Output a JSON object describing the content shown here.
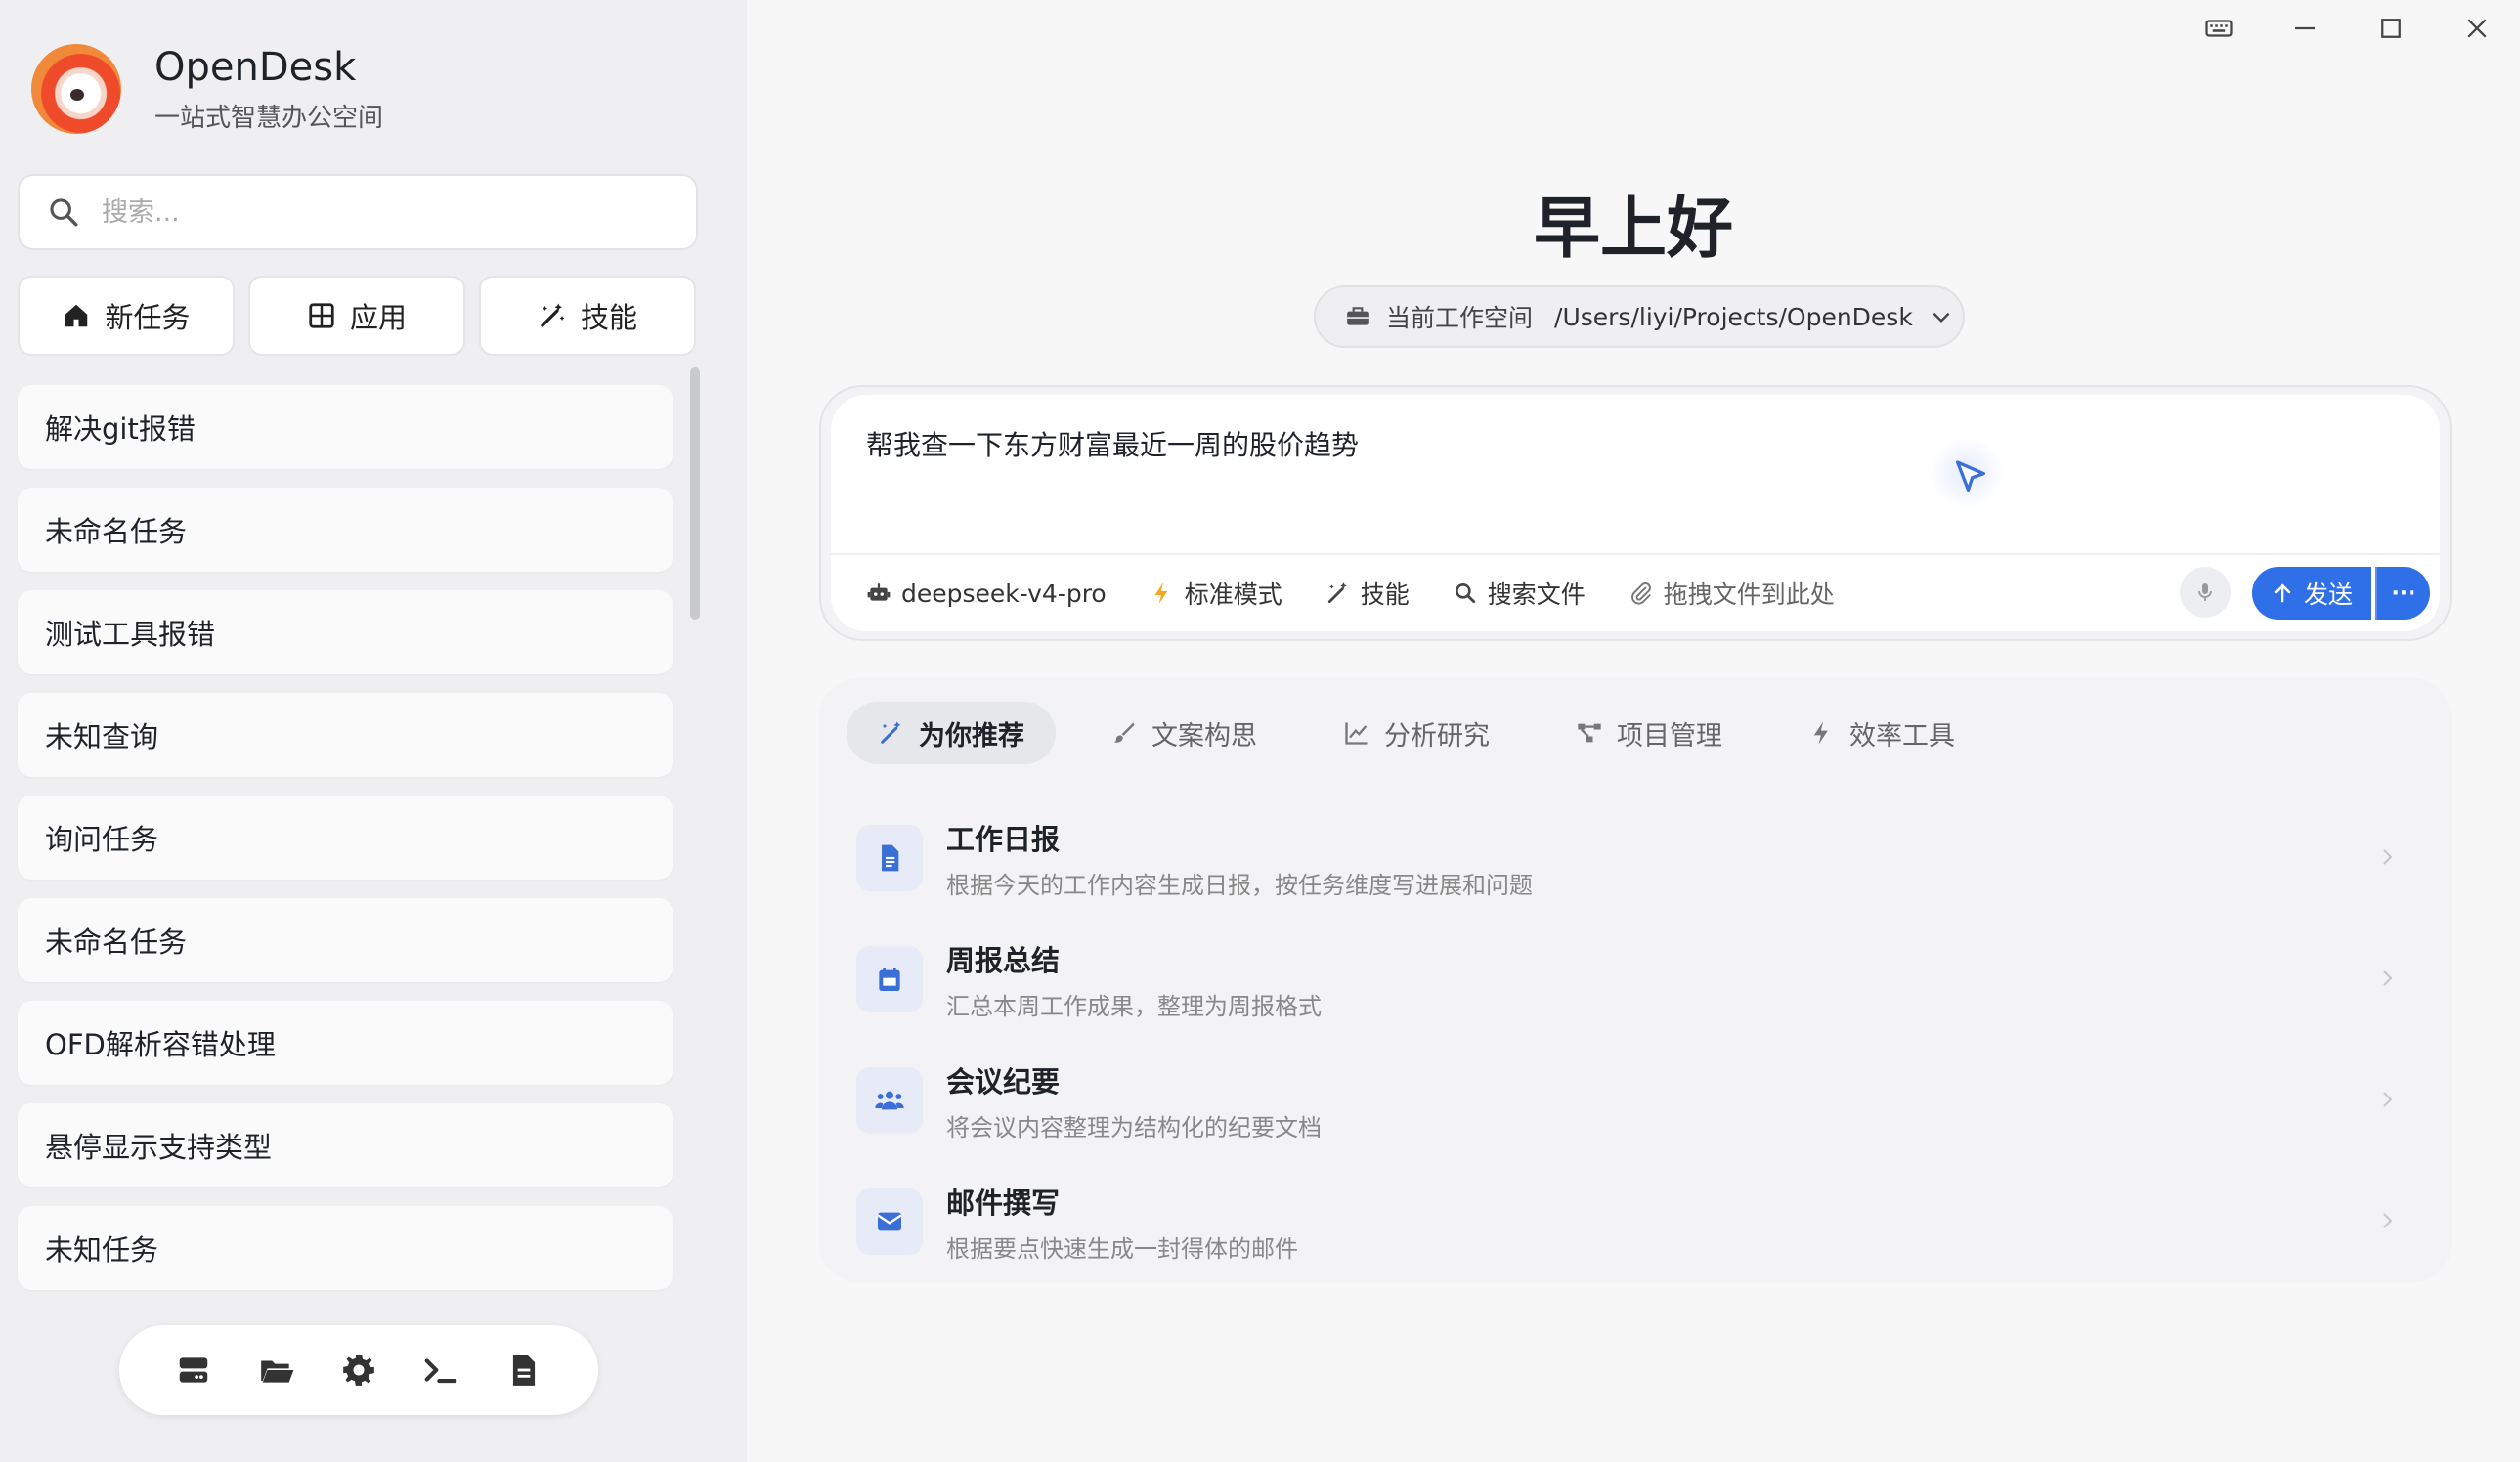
{
  "brand": {
    "title": "OpenDesk",
    "subtitle": "一站式智慧办公空间"
  },
  "search": {
    "placeholder": "搜索..."
  },
  "quick_actions": [
    {
      "label": "新任务",
      "icon": "home-icon"
    },
    {
      "label": "应用",
      "icon": "grid-icon"
    },
    {
      "label": "技能",
      "icon": "magic-wand-icon"
    }
  ],
  "tasks": [
    "解决git报错",
    "未命名任务",
    "测试工具报错",
    "未知查询",
    "询问任务",
    "未命名任务",
    "OFD解析容错处理",
    "悬停显示支持类型",
    "未知任务"
  ],
  "dock_icons": [
    "server-icon",
    "folder-open-icon",
    "gear-icon",
    "terminal-icon",
    "document-icon"
  ],
  "window_controls": [
    "keyboard-icon",
    "minimize-icon",
    "maximize-icon",
    "close-icon"
  ],
  "main": {
    "greeting": "早上好",
    "workspace": {
      "label": "当前工作空间",
      "path": "/Users/liyi/Projects/OpenDesk"
    },
    "composer": {
      "prompt": "帮我查一下东方财富最近一周的股价趋势",
      "model": "deepseek-v4-pro",
      "mode": "标准模式",
      "skills": "技能",
      "search_files": "搜索文件",
      "drop_hint": "拖拽文件到此处",
      "send": "发送",
      "more": "···"
    },
    "tabs": [
      {
        "label": "为你推荐",
        "icon": "magic-wand-icon",
        "active": true
      },
      {
        "label": "文案构思",
        "icon": "brush-icon"
      },
      {
        "label": "分析研究",
        "icon": "chart-line-icon"
      },
      {
        "label": "项目管理",
        "icon": "project-diagram-icon"
      },
      {
        "label": "效率工具",
        "icon": "bolt-icon"
      }
    ],
    "recommendations": [
      {
        "title": "工作日报",
        "desc": "根据今天的工作内容生成日报，按任务维度写进展和问题",
        "icon": "file-text-icon"
      },
      {
        "title": "周报总结",
        "desc": "汇总本周工作成果，整理为周报格式",
        "icon": "calendar-icon"
      },
      {
        "title": "会议纪要",
        "desc": "将会议内容整理为结构化的纪要文档",
        "icon": "users-icon"
      },
      {
        "title": "邮件撰写",
        "desc": "根据要点快速生成一封得体的邮件",
        "icon": "envelope-icon"
      }
    ]
  },
  "colors": {
    "accent": "#2f6fe8",
    "icon_accent": "#3b6fd8",
    "sidebar_bg": "#efeff1",
    "main_bg": "#f7f7f8"
  }
}
